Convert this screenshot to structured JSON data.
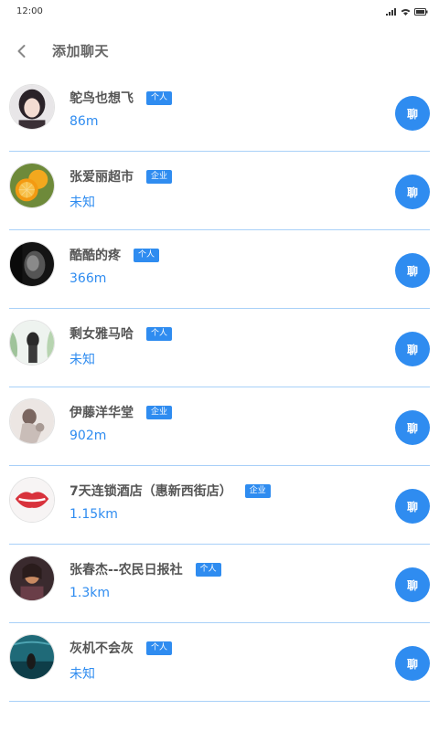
{
  "status_bar": {
    "time": "12:00"
  },
  "header": {
    "title": "添加聊天",
    "back_icon": "chevron-left-icon"
  },
  "contacts": [
    {
      "name": "鸵鸟也想飞",
      "type": "个人",
      "distance": "86m",
      "chat_label": "聊"
    },
    {
      "name": "张爱丽超市",
      "type": "企业",
      "distance": "未知",
      "chat_label": "聊"
    },
    {
      "name": "酷酷的疼",
      "type": "个人",
      "distance": "366m",
      "chat_label": "聊"
    },
    {
      "name": "剩女雅马哈",
      "type": "个人",
      "distance": "未知",
      "chat_label": "聊"
    },
    {
      "name": "伊藤洋华堂",
      "type": "企业",
      "distance": "902m",
      "chat_label": "聊"
    },
    {
      "name": "7天连锁酒店（惠新西街店）",
      "type": "企业",
      "distance": "1.15km",
      "chat_label": "聊"
    },
    {
      "name": "张春杰--农民日报社",
      "type": "个人",
      "distance": "1.3km",
      "chat_label": "聊"
    },
    {
      "name": "灰机不会灰",
      "type": "个人",
      "distance": "未知",
      "chat_label": "聊"
    }
  ],
  "colors": {
    "accent": "#2f8cf0",
    "divider": "#a8d0f8",
    "text": "#555555"
  }
}
